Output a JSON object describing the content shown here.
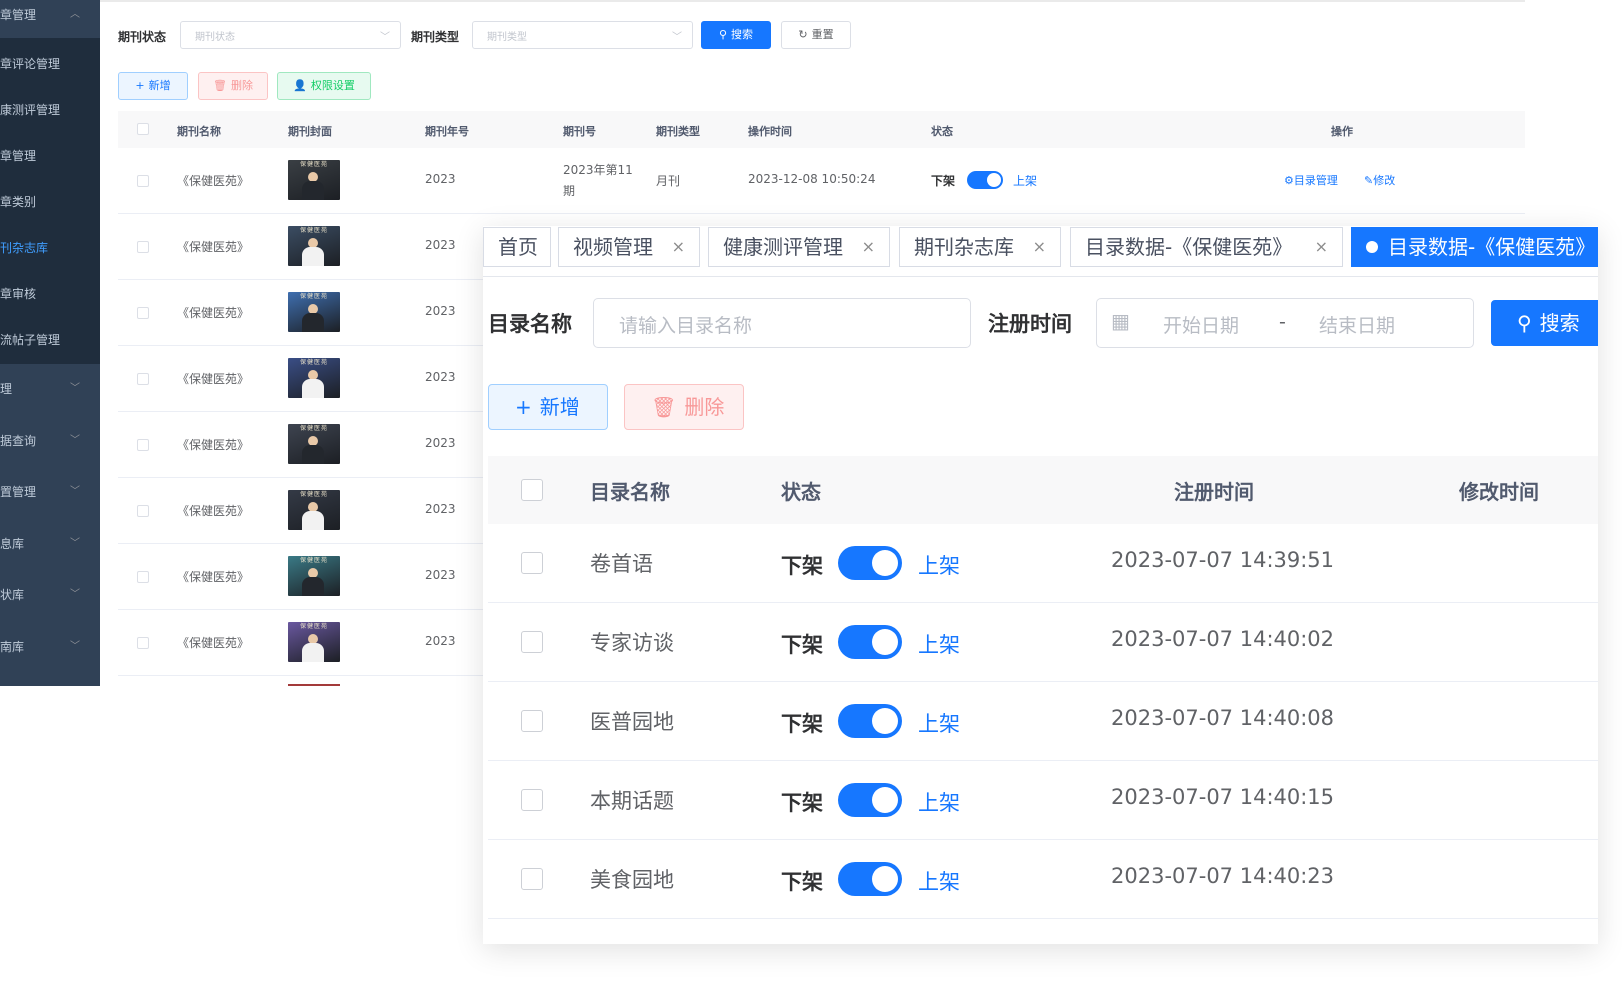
{
  "sidebar": {
    "items": [
      {
        "label": "章管理",
        "chevron": "up"
      },
      {
        "label": "章评论管理"
      },
      {
        "label": "康测评管理"
      },
      {
        "label": "章管理"
      },
      {
        "label": "章类别"
      },
      {
        "label": "刊杂志库",
        "active": true
      },
      {
        "label": "章审核"
      },
      {
        "label": "流帖子管理"
      },
      {
        "label": "理",
        "chevron": "down"
      },
      {
        "label": "据查询",
        "chevron": "down"
      },
      {
        "label": "置管理",
        "chevron": "down"
      },
      {
        "label": "息库",
        "chevron": "down"
      },
      {
        "label": "状库",
        "chevron": "down"
      },
      {
        "label": "南库",
        "chevron": "down"
      }
    ]
  },
  "filters": {
    "status_label": "期刊状态",
    "status_placeholder": "期刊状态",
    "type_label": "期刊类型",
    "type_placeholder": "期刊类型",
    "search_label": "搜索",
    "reset_label": "重置"
  },
  "actions": {
    "add_label": "新增",
    "delete_label": "删除",
    "permission_label": "权限设置"
  },
  "journal_table": {
    "headers": [
      "期刊名称",
      "期刊封面",
      "期刊年号",
      "期刊号",
      "期刊类型",
      "操作时间",
      "状态",
      "操作"
    ],
    "rows": [
      {
        "name": "《保健医苑》",
        "year": "2023",
        "issue": "2023年第11",
        "issue2": "期",
        "type": "月刊",
        "time": "2023-12-08 10:50:24",
        "off": "下架",
        "on": "上架",
        "op1": "目录管理",
        "op2": "修改"
      },
      {
        "name": "《保健医苑》",
        "year": "2023"
      },
      {
        "name": "《保健医苑》",
        "year": "2023"
      },
      {
        "name": "《保健医苑》",
        "year": "2023"
      },
      {
        "name": "《保健医苑》",
        "year": "2023"
      },
      {
        "name": "《保健医苑》",
        "year": "2023"
      },
      {
        "name": "《保健医苑》",
        "year": "2023"
      },
      {
        "name": "《保健医苑》",
        "year": "2023"
      }
    ],
    "cover_title": "保健医苑",
    "cover_colors": [
      "#3a3f44",
      "#3b4d63",
      "#3f6fb0",
      "#3a4e86",
      "#3e4450",
      "#343a46",
      "#3a7a86",
      "#6a58a0"
    ]
  },
  "tags": [
    {
      "label": "首页",
      "closable": false
    },
    {
      "label": "视频管理",
      "closable": true
    },
    {
      "label": "健康测评管理",
      "closable": true
    },
    {
      "label": "期刊杂志库",
      "closable": true
    },
    {
      "label": "目录数据-《保健医苑》",
      "closable": true
    },
    {
      "label": "目录数据-《保健医苑》",
      "active": true
    }
  ],
  "catalog": {
    "name_label": "目录名称",
    "name_placeholder": "请输入目录名称",
    "date_label": "注册时间",
    "start_placeholder": "开始日期",
    "date_sep": "-",
    "end_placeholder": "结束日期",
    "search_label": "搜索",
    "add_label": "新增",
    "delete_label": "删除",
    "headers": [
      "目录名称",
      "状态",
      "注册时间",
      "修改时间"
    ],
    "rows": [
      {
        "name": "卷首语",
        "off": "下架",
        "on": "上架",
        "time": "2023-07-07 14:39:51"
      },
      {
        "name": "专家访谈",
        "off": "下架",
        "on": "上架",
        "time": "2023-07-07 14:40:02"
      },
      {
        "name": "医普园地",
        "off": "下架",
        "on": "上架",
        "time": "2023-07-07 14:40:08"
      },
      {
        "name": "本期话题",
        "off": "下架",
        "on": "上架",
        "time": "2023-07-07 14:40:15"
      },
      {
        "name": "美食园地",
        "off": "下架",
        "on": "上架",
        "time": "2023-07-07 14:40:23"
      }
    ]
  },
  "colors": {
    "primary": "#1677ff",
    "sidebar_bg": "#304156",
    "sidebar_sub_bg": "#1f2d3d",
    "danger": "#f56c6c",
    "success": "#13ce66"
  }
}
